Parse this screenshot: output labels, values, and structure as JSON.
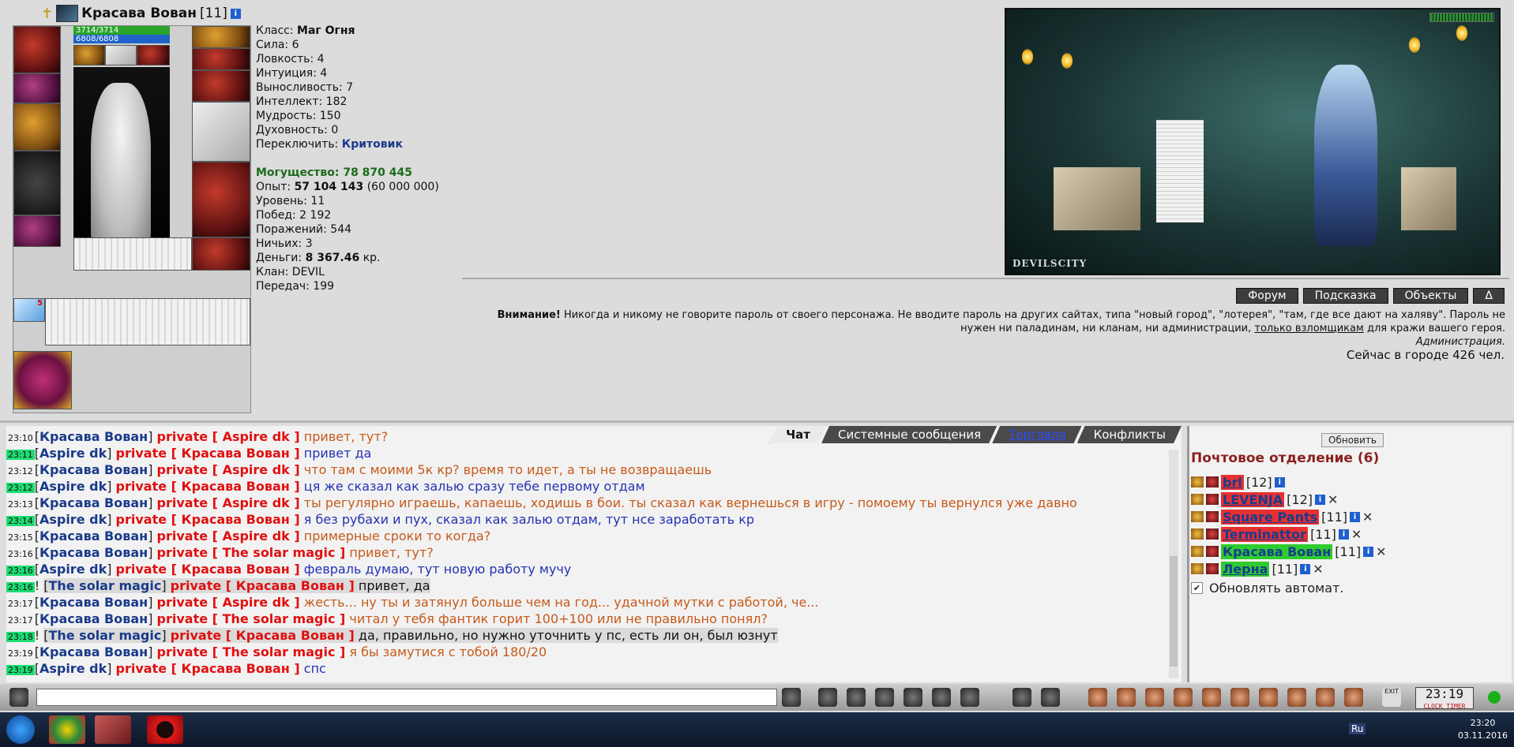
{
  "character": {
    "name": "Красава Вован",
    "level": "[11]",
    "info": "i",
    "hp": "3714/3714",
    "mp": "6808/6808",
    "hp_fraction": 1.0,
    "mp_fraction": 1.0,
    "scroll_count": "5"
  },
  "stats": {
    "class_label": "Класс:",
    "class_value": "Маг Огня",
    "str": "Сила: 6",
    "agi": "Ловкость: 4",
    "int": "Интуиция: 4",
    "vit": "Выносливость: 7",
    "intellect": "Интеллект: 182",
    "wis": "Мудрость: 150",
    "spirit": "Духовность: 0",
    "switch_label": "Переключить:",
    "switch_value": "Критовик",
    "power_label": "Могущество:",
    "power_value": "78 870 445",
    "exp_label": "Опыт:",
    "exp_value": "57 104 143",
    "exp_next": "(60 000 000)",
    "level": "Уровень: 11",
    "wins": "Побед: 2 192",
    "losses": "Поражений: 544",
    "draws": "Ничьих: 3",
    "money_label": "Деньги:",
    "money_value": "8 367.46",
    "money_unit": "кр.",
    "clan": "Клан: DEVIL",
    "transfers": "Передач: 199"
  },
  "scene": {
    "logo": "DEVILSCITY"
  },
  "top_buttons": [
    "Форум",
    "Подсказка",
    "Объекты",
    "Δ"
  ],
  "warning": {
    "bold": "Внимание!",
    "text1": "Никогда и никому не говорите пароль от своего персонажа. Не вводите пароль на других сайтах, типа \"новый город\", \"лотерея\", \"там, где все дают на халяву\". Пароль не нужен ни паладинам, ни кланам, ни администрации,",
    "link": "только взломщикам",
    "text2": "для кражи вашего героя.",
    "signature": "Администрация."
  },
  "online": "Сейчас в городе 426 чел.",
  "chat": {
    "tabs": [
      "Чат",
      "Системные сообщения",
      "Торговля",
      "Конфликты"
    ],
    "lines": [
      {
        "time": "23:10",
        "green": false,
        "from": "Красава Вован",
        "to": "Aspire dk",
        "text": "привет, тут?",
        "own": true,
        "hl": false
      },
      {
        "time": "23:11",
        "green": true,
        "from": "Aspire dk",
        "to": "Красава Вован",
        "text": "привет да",
        "own": false,
        "hl": false
      },
      {
        "time": "23:12",
        "green": false,
        "from": "Красава Вован",
        "to": "Aspire dk",
        "text": "что там с моими 5к кр? время то идет, а ты не возвращаешь",
        "own": true,
        "hl": false
      },
      {
        "time": "23:12",
        "green": true,
        "from": "Aspire dk",
        "to": "Красава Вован",
        "text": "ця же сказал как залью сразу тебе первому отдам",
        "own": false,
        "hl": false
      },
      {
        "time": "23:13",
        "green": false,
        "from": "Красава Вован",
        "to": "Aspire dk",
        "text": "ты регулярно играешь, капаешь, ходишь в бои. ты сказал как вернешься в игру - помоему ты вернулся уже давно",
        "own": true,
        "hl": false
      },
      {
        "time": "23:14",
        "green": true,
        "from": "Aspire dk",
        "to": "Красава Вован",
        "text": "я без рубахи и пух, сказал как залью отдам, тут нсе заработать кр",
        "own": false,
        "hl": false
      },
      {
        "time": "23:15",
        "green": false,
        "from": "Красава Вован",
        "to": "Aspire dk",
        "text": "примерные сроки то когда?",
        "own": true,
        "hl": false
      },
      {
        "time": "23:16",
        "green": false,
        "from": "Красава Вован",
        "to": "The solar magic",
        "text": "привет, тут?",
        "own": true,
        "hl": false
      },
      {
        "time": "23:16",
        "green": true,
        "from": "Aspire dk",
        "to": "Красава Вован",
        "text": "февраль думаю, тут новую работу мучу",
        "own": false,
        "hl": false
      },
      {
        "time": "23:16",
        "green": true,
        "from": "The solar magic",
        "to": "Красава Вован",
        "text": "привет, да",
        "own": false,
        "hl": true
      },
      {
        "time": "23:17",
        "green": false,
        "from": "Красава Вован",
        "to": "Aspire dk",
        "text": "жесть... ну ты и затянул больше чем на год... удачной мутки с работой, че...",
        "own": true,
        "hl": false
      },
      {
        "time": "23:17",
        "green": false,
        "from": "Красава Вован",
        "to": "The solar magic",
        "text": "читал у тебя фантик горит 100+100 или не правильно понял?",
        "own": true,
        "hl": false
      },
      {
        "time": "23:18",
        "green": true,
        "from": "The solar magic",
        "to": "Красава Вован",
        "text": "да, правильно, но нужно уточнить у пс, есть ли он, был юзнут",
        "own": false,
        "hl": true
      },
      {
        "time": "23:19",
        "green": false,
        "from": "Красава Вован",
        "to": "The solar magic",
        "text": "я бы замутися с тобой 180/20",
        "own": true,
        "hl": false
      },
      {
        "time": "23:19",
        "green": true,
        "from": "Aspire dk",
        "to": "Красава Вован",
        "text": "спс",
        "own": false,
        "hl": false
      }
    ],
    "private_word": "private"
  },
  "mail": {
    "refresh": "Обновить",
    "title": "Почтовое отделение (6)",
    "users": [
      {
        "name": "brl",
        "level": "[12]",
        "style": "r",
        "x": false
      },
      {
        "name": "LEVENJA",
        "level": "[12]",
        "style": "r",
        "x": true
      },
      {
        "name": "Square Pants",
        "level": "[11]",
        "style": "r",
        "x": true
      },
      {
        "name": "Terminattor",
        "level": "[11]",
        "style": "r",
        "x": true
      },
      {
        "name": "Красава Вован",
        "level": "[11]",
        "style": "g",
        "x": true
      },
      {
        "name": "Лерна",
        "level": "[11]",
        "style": "g2",
        "x": true
      }
    ],
    "auto": "Обновлять автомат.",
    "auto_checked": "✔"
  },
  "clock": {
    "time": "23:19",
    "seconds": "19",
    "clock_label": "CLOCK",
    "timer_label": "TIMER",
    "exit": "EXIT"
  },
  "taskbar": {
    "lang": "Ru",
    "time": "23:20",
    "date": "03.11.2016"
  }
}
